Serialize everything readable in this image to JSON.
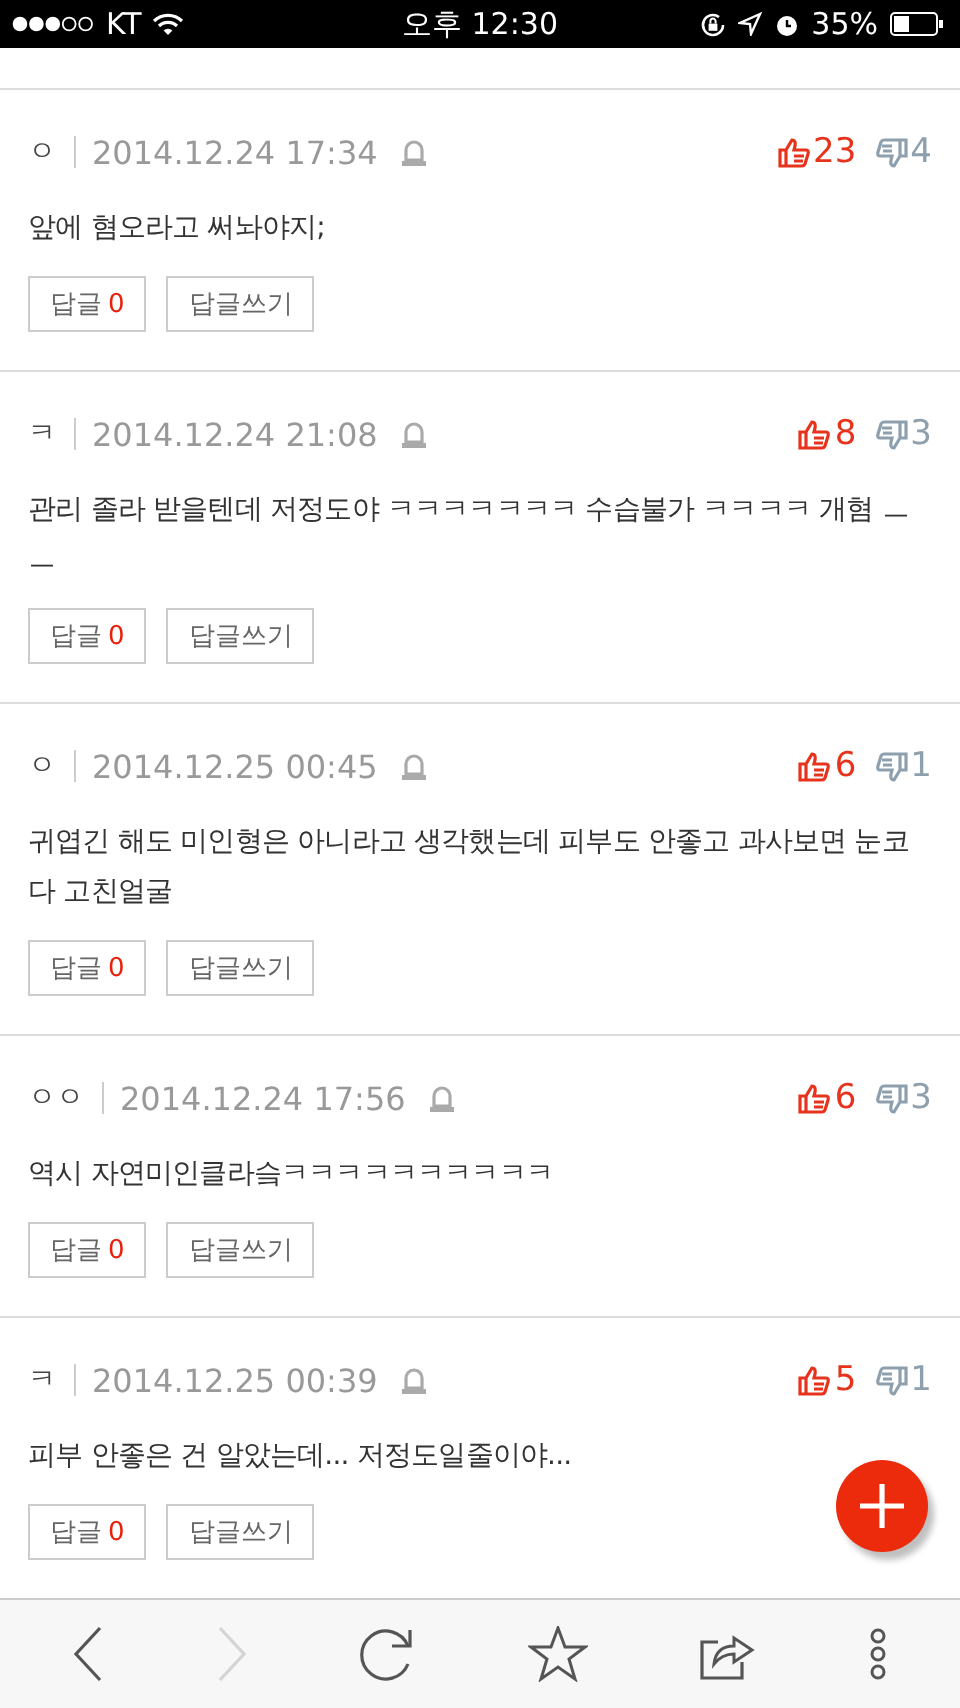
{
  "status_bar": {
    "carrier": "KT",
    "time": "오후 12:30",
    "battery": "35%"
  },
  "comments": [
    {
      "author": "ㅇ",
      "date": "2014.12.24 17:34",
      "likes": "23",
      "dislikes": "4",
      "text": "앞에 혐오라고 써놔야지;",
      "reply_label": "답글",
      "reply_count": "0",
      "write_label": "답글쓰기"
    },
    {
      "author": "ㅋ",
      "date": "2014.12.24 21:08",
      "likes": "8",
      "dislikes": "3",
      "text": "관리 졸라 받을텐데 저정도야 ㅋㅋㅋㅋㅋㅋㅋ 수습불가 ㅋㅋㅋㅋ 개혐 ㅡㅡ",
      "reply_label": "답글",
      "reply_count": "0",
      "write_label": "답글쓰기"
    },
    {
      "author": "ㅇ",
      "date": "2014.12.25 00:45",
      "likes": "6",
      "dislikes": "1",
      "text": "귀엽긴 해도 미인형은 아니라고 생각했는데 피부도 안좋고 과사보면 눈코 다 고친얼굴",
      "reply_label": "답글",
      "reply_count": "0",
      "write_label": "답글쓰기"
    },
    {
      "author": "ㅇㅇ",
      "date": "2014.12.24 17:56",
      "likes": "6",
      "dislikes": "3",
      "text": "역시 자연미인클라슼ㅋㅋㅋㅋㅋㅋㅋㅋㅋㅋ",
      "reply_label": "답글",
      "reply_count": "0",
      "write_label": "답글쓰기"
    },
    {
      "author": "ㅋ",
      "date": "2014.12.25 00:39",
      "likes": "5",
      "dislikes": "1",
      "text": "피부 안좋은 건 알았는데... 저정도일줄이야...",
      "reply_label": "답글",
      "reply_count": "0",
      "write_label": "답글쓰기"
    }
  ],
  "toolbar": [
    {
      "kind": "back",
      "disabled": false
    },
    {
      "kind": "forward",
      "disabled": true
    },
    {
      "kind": "reload",
      "disabled": false
    },
    {
      "kind": "bookmark",
      "disabled": false
    },
    {
      "kind": "share",
      "disabled": false
    },
    {
      "kind": "more",
      "disabled": false
    }
  ]
}
